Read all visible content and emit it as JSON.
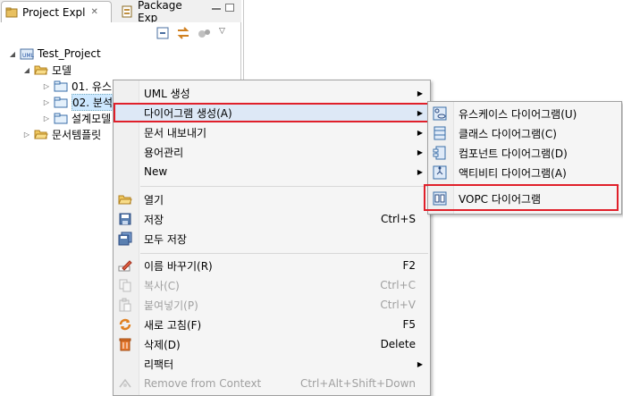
{
  "tabs": {
    "active_label": "Project Expl",
    "inactive_label": "Package Exp"
  },
  "tree": {
    "root": "Test_Project",
    "model": "모델",
    "item1": "01. 유스",
    "item2": "02. 분석",
    "item3": "설계모델",
    "templates": "문서템플릿"
  },
  "menu": {
    "uml": "UML 생성",
    "diagram": "다이어그램 생성(A)",
    "export": "문서 내보내기",
    "glossary": "용어관리",
    "new": "New",
    "open": "열기",
    "save": "저장",
    "save_shortcut": "Ctrl+S",
    "save_all": "모두 저장",
    "rename": "이름 바꾸기(R)",
    "rename_shortcut": "F2",
    "copy": "복사(C)",
    "copy_shortcut": "Ctrl+C",
    "paste": "붙여넣기(P)",
    "paste_shortcut": "Ctrl+V",
    "refresh": "새로 고침(F)",
    "refresh_shortcut": "F5",
    "delete": "삭제(D)",
    "delete_shortcut": "Delete",
    "refactor": "리팩터",
    "remove_context": "Remove from Context",
    "remove_context_shortcut": "Ctrl+Alt+Shift+Down"
  },
  "submenu": {
    "usecase": "유스케이스 다이어그램(U)",
    "class": "클래스 다이어그램(C)",
    "component": "컴포넌트 다이어그램(D)",
    "activity": "액티비티 다이어그램(A)",
    "vopc": "VOPC 다이어그램"
  },
  "colors": {
    "highlight": "#e0202a",
    "selection": "#cde8ff"
  }
}
